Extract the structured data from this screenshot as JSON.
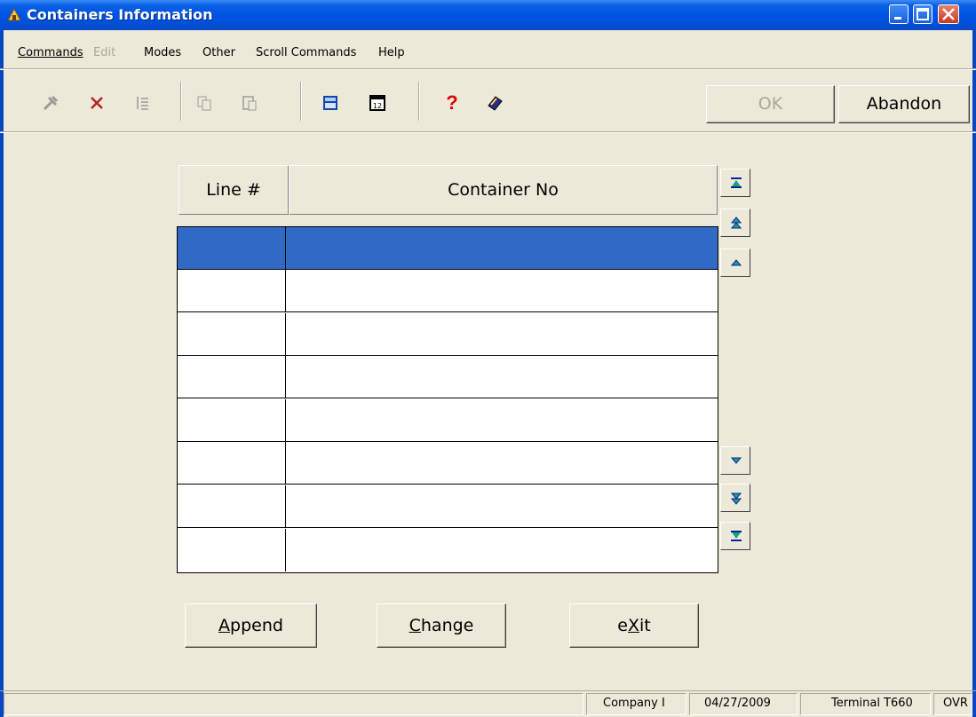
{
  "window": {
    "title": "Containers Information"
  },
  "menu": {
    "items": [
      {
        "label": "Commands",
        "disabled": false
      },
      {
        "label": "Edit",
        "disabled": true
      },
      {
        "label": "Modes",
        "disabled": false
      },
      {
        "label": "Other",
        "disabled": false
      },
      {
        "label": "Scroll Commands",
        "disabled": false
      },
      {
        "label": "Help",
        "disabled": false
      }
    ]
  },
  "toolbar": {
    "icons": [
      "tools-icon",
      "delete-icon",
      "list-icon",
      "copy-icon",
      "paste-icon",
      "calculator-icon",
      "calendar-icon",
      "help-icon",
      "book-icon"
    ],
    "ok_label": "OK",
    "abandon_label": "Abandon"
  },
  "grid": {
    "columns": [
      "Line #",
      "Container No"
    ],
    "rows": [
      {
        "line": "",
        "container": "",
        "selected": true
      },
      {
        "line": "",
        "container": ""
      },
      {
        "line": "",
        "container": ""
      },
      {
        "line": "",
        "container": ""
      },
      {
        "line": "",
        "container": ""
      },
      {
        "line": "",
        "container": ""
      },
      {
        "line": "",
        "container": ""
      },
      {
        "line": "",
        "container": ""
      }
    ]
  },
  "actions": {
    "append": {
      "pre": "",
      "mnemonic": "A",
      "post": "ppend"
    },
    "change": {
      "pre": "",
      "mnemonic": "C",
      "post": "hange"
    },
    "exit": {
      "pre": "e",
      "mnemonic": "X",
      "post": "it"
    }
  },
  "status": {
    "company": "Company I",
    "date": "04/27/2009",
    "terminal": "Terminal T660",
    "mode": "OVR"
  },
  "colors": {
    "titlebar": "#0054e3",
    "selection": "#316ac5",
    "face": "#ece9d8"
  }
}
